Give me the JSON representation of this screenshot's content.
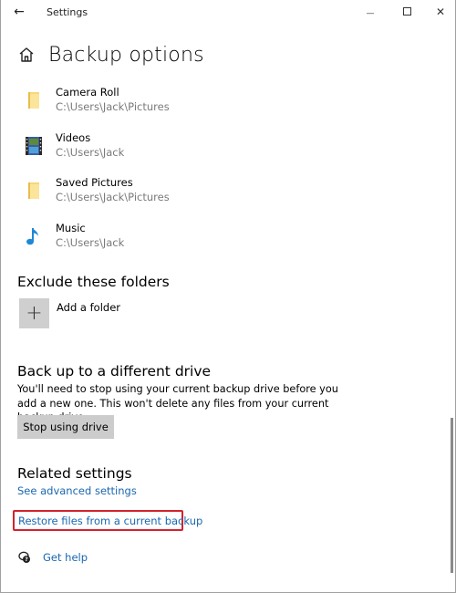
{
  "window": {
    "title": "Settings",
    "back_glyph": "←",
    "minimize_glyph": "—",
    "close_glyph": "✕"
  },
  "header": {
    "title": "Backup options",
    "icon": "home-icon"
  },
  "folders": [
    {
      "name": "Camera Roll",
      "path": "C:\\Users\\Jack\\Pictures",
      "icon": "folder-icon"
    },
    {
      "name": "Videos",
      "path": "C:\\Users\\Jack",
      "icon": "videos-icon"
    },
    {
      "name": "Saved Pictures",
      "path": "C:\\Users\\Jack\\Pictures",
      "icon": "folder-icon"
    },
    {
      "name": "Music",
      "path": "C:\\Users\\Jack",
      "icon": "music-icon"
    }
  ],
  "exclude": {
    "heading": "Exclude these folders",
    "add_glyph": "+",
    "add_label": "Add a folder"
  },
  "different_drive": {
    "heading": "Back up to a different drive",
    "description": "You'll need to stop using your current backup drive before you add a new one. This won't delete any files from your current backup drive.",
    "button_label": "Stop using drive"
  },
  "related": {
    "heading": "Related settings",
    "links": [
      "See advanced settings",
      "Restore files from a current backup"
    ],
    "highlight_color": "#d2232e"
  },
  "help": {
    "label": "Get help",
    "icon": "help-chat-icon"
  },
  "colors": {
    "link": "#1a67b0",
    "folder_yellow": "#f8d775",
    "music_blue": "#1e88d6"
  }
}
